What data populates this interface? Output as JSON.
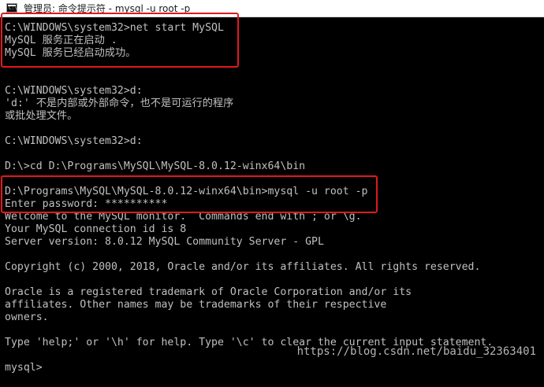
{
  "window": {
    "title": "管理员: 命令提示符 - mysql  -u root -p"
  },
  "console": {
    "lines": [
      "C:\\WINDOWS\\system32>net start MySQL",
      "MySQL 服务正在启动 .",
      "MySQL 服务已经启动成功。",
      "",
      "",
      "C:\\WINDOWS\\system32>d:",
      "'d:' 不是内部或外部命令，也不是可运行的程序",
      "或批处理文件。",
      "",
      "C:\\WINDOWS\\system32>d:",
      "",
      "D:\\>cd D:\\Programs\\MySQL\\MySQL-8.0.12-winx64\\bin",
      "",
      "D:\\Programs\\MySQL\\MySQL-8.0.12-winx64\\bin>mysql -u root -p",
      "Enter password: **********",
      "Welcome to the MySQL monitor.  Commands end with ; or \\g.",
      "Your MySQL connection id is 8",
      "Server version: 8.0.12 MySQL Community Server - GPL",
      "",
      "Copyright (c) 2000, 2018, Oracle and/or its affiliates. All rights reserved.",
      "",
      "Oracle is a registered trademark of Oracle Corporation and/or its",
      "affiliates. Other names may be trademarks of their respective",
      "owners.",
      "",
      "Type 'help;' or '\\h' for help. Type '\\c' to clear the current input statement.",
      "",
      "mysql>"
    ]
  },
  "watermark": "https://blog.csdn.net/baidu_32363401",
  "colors": {
    "console_background": "#000000",
    "console_text": "#c0c0c0",
    "highlight_border": "#e0191f",
    "watermark": "#b5b5b5"
  }
}
